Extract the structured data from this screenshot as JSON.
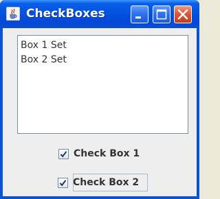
{
  "window": {
    "title": "CheckBoxes",
    "controls": {
      "minimize": "minimize-icon",
      "maximize": "maximize-icon",
      "close": "close-icon"
    }
  },
  "output_area": {
    "lines": [
      "Box 1 Set",
      "Box 2 Set"
    ]
  },
  "checkboxes": [
    {
      "label": "Check Box 1",
      "checked": true
    },
    {
      "label": "Check Box 2",
      "checked": true,
      "focused": true
    }
  ],
  "colors": {
    "titlebar": "#0553e0",
    "close_button": "#e0563a",
    "client_bg": "#eeeeee"
  }
}
